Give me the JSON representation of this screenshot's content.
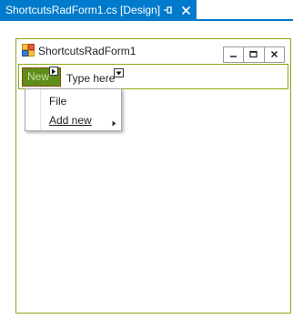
{
  "document_tab": {
    "title": "ShortcutsRadForm1.cs [Design]",
    "pin_glyph": "⊣",
    "close_glyph": "✕"
  },
  "form": {
    "title": "ShortcutsRadForm1",
    "icon": "form-icon",
    "caption_buttons": [
      "minimize-icon",
      "maximize-icon",
      "close-icon"
    ]
  },
  "menu_bar": {
    "items": [
      {
        "label": "New"
      }
    ],
    "placeholder": "Type here"
  },
  "dropdown": {
    "items": [
      {
        "label": "File",
        "has_submenu": false
      },
      {
        "label": "Add new",
        "has_submenu": true
      }
    ]
  },
  "colors": {
    "tab_accent": "#007acc",
    "form_border": "#8ca815",
    "selected_item_bg": "#5f8d1a"
  }
}
